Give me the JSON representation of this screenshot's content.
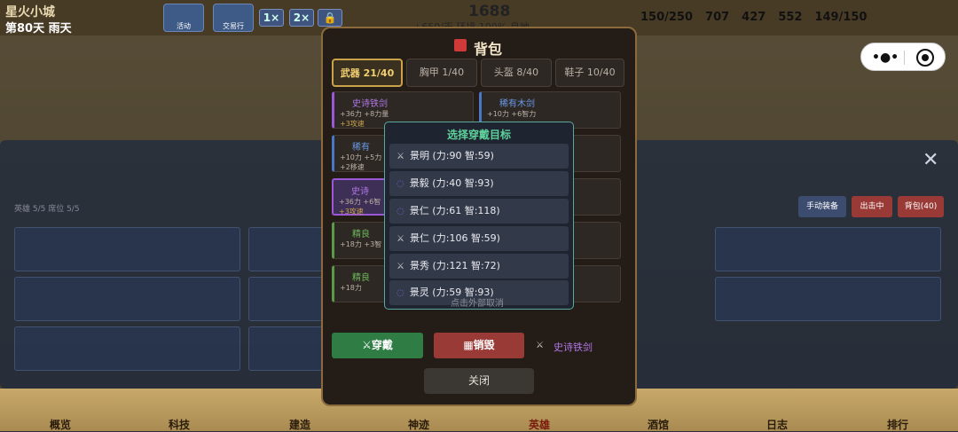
{
  "top": {
    "city": "星火小城",
    "day": "第80天",
    "weather": "雨天",
    "btn1": "活动",
    "btn2": "交易行",
    "speed1": "1×",
    "speed2": "2×",
    "gold": "1688",
    "gold_sub": "+650/天 环境 100%",
    "gold_sub2": "良地",
    "resources": [
      "150/250",
      "707",
      "427",
      "552",
      "149/150"
    ]
  },
  "bag": {
    "title": "背包",
    "categories": [
      "武器 21/40",
      "胸甲 1/40",
      "头盔 8/40",
      "鞋子 10/40"
    ],
    "items": [
      {
        "name": "史诗铁剑",
        "stat": "+36力 +8力量",
        "extra": "+3攻速"
      },
      {
        "name": "稀有木剑",
        "stat": "+10力 +6智力",
        "extra": ""
      },
      {
        "name": "稀有",
        "stat": "+10力 +5力",
        "extra": "+2移速"
      },
      {
        "name": "史诗",
        "stat": "+36力 +6智",
        "extra": "+3攻速"
      },
      {
        "name": "精良",
        "stat": "+18力 +3智",
        "extra": ""
      },
      {
        "name": "精良",
        "stat": "+18力",
        "extra": ""
      }
    ],
    "wear_label": "穿戴",
    "destroy_label": "销毁",
    "selected": "史诗铁剑",
    "close_label": "关闭"
  },
  "picker": {
    "title": "选择穿戴目标",
    "options": [
      "景明 (力:90 智:59)",
      "景毅 (力:40 智:93)",
      "景仁 (力:61 智:118)",
      "景仁 (力:106 智:59)",
      "景秀 (力:121 智:72)",
      "景灵 (力:59 智:93)"
    ],
    "cancel": "点击外部取消"
  },
  "hero_panel": {
    "tab": "英雄 5/5 席位 5/5",
    "manual": "手动装备",
    "go": "出击中",
    "bag": "背包(40)",
    "badge": "40"
  },
  "nav": [
    "概览",
    "科技",
    "建造",
    "神迹",
    "英雄",
    "酒馆",
    "日志",
    "排行"
  ]
}
